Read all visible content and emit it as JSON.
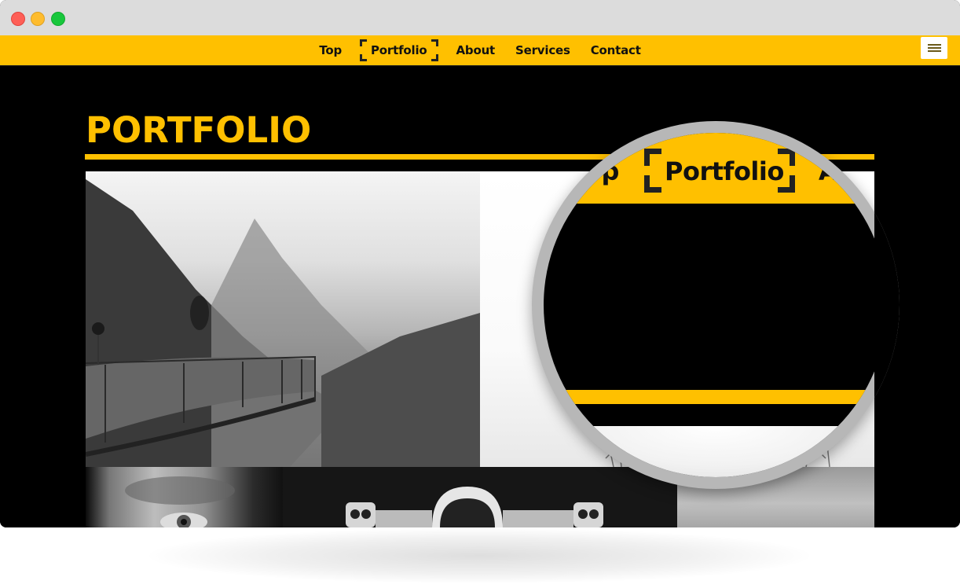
{
  "window": {
    "controls": [
      "close",
      "minimize",
      "maximize"
    ]
  },
  "nav": {
    "items": [
      {
        "label": "Top",
        "active": false
      },
      {
        "label": "Portfolio",
        "active": true
      },
      {
        "label": "About",
        "active": false
      },
      {
        "label": "Services",
        "active": false
      },
      {
        "label": "Contact",
        "active": false
      }
    ],
    "menu_icon": "hamburger-icon"
  },
  "main": {
    "title": "PORTFOLIO",
    "tiles": [
      {
        "description": "Person jumping on mountain viewpoint platform, black and white"
      },
      {
        "description": "White background with structure at bottom, black and white"
      },
      {
        "description": "Close-up of aged man's eye, black and white"
      },
      {
        "description": "Astronaut helmet with lights, black and white"
      },
      {
        "description": "Cloudy sky texture, black and white"
      }
    ]
  },
  "magnifier": {
    "left_text": "op",
    "active_text": "Portfolio",
    "right_text": "Ab"
  },
  "colors": {
    "accent": "#ffc000",
    "background": "#000000",
    "titlebar": "#dcdcdc",
    "nav_text": "#111111"
  }
}
